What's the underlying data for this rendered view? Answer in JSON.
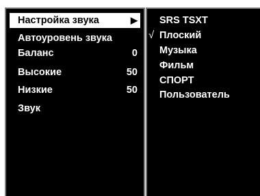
{
  "menu": {
    "items": [
      {
        "label": "Настройка звука",
        "value": "",
        "arrow": "▶",
        "selected": true
      },
      {
        "label": "Автоуровень звука",
        "value": "",
        "arrow": "",
        "selected": false
      },
      {
        "label": "Баланс",
        "value": "0",
        "arrow": "",
        "selected": false
      },
      {
        "label": "Высокие",
        "value": "50",
        "arrow": "",
        "selected": false
      },
      {
        "label": "Низкие",
        "value": "50",
        "arrow": "",
        "selected": false
      },
      {
        "label": "Звук",
        "value": "",
        "arrow": "",
        "selected": false
      }
    ]
  },
  "submenu": {
    "options": [
      {
        "label": "SRS TSXT",
        "check": ""
      },
      {
        "label": "Плоский",
        "check": "√"
      },
      {
        "label": "Музыка",
        "check": ""
      },
      {
        "label": "Фильм",
        "check": ""
      },
      {
        "label": "СПОРТ",
        "check": ""
      },
      {
        "label": "Пользователь",
        "check": ""
      }
    ]
  },
  "colors": {
    "panel_bg": "#000000",
    "panel_border": "#7a7a7a",
    "text": "#ffffff",
    "highlight_bg": "#ffffff",
    "highlight_text": "#000000"
  }
}
